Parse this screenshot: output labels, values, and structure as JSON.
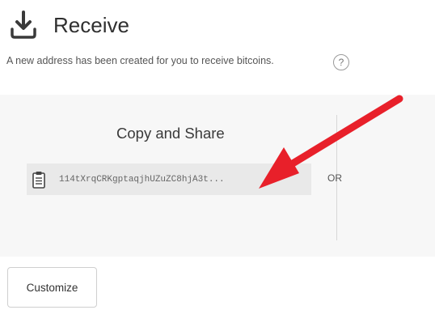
{
  "header": {
    "title": "Receive",
    "icon": "download-icon"
  },
  "subtitle": "A new address has been created for you to receive bitcoins.",
  "help": {
    "icon": "help-icon",
    "glyph": "?"
  },
  "share": {
    "title": "Copy and Share",
    "copy_icon": "clipboard-icon",
    "address": "114tXrqCRKgptaqjhUZuZC8hjA3t...",
    "or_label": "OR"
  },
  "annotation": {
    "icon": "arrow-icon",
    "color": "#e8202a"
  },
  "footer": {
    "customize_label": "Customize"
  }
}
